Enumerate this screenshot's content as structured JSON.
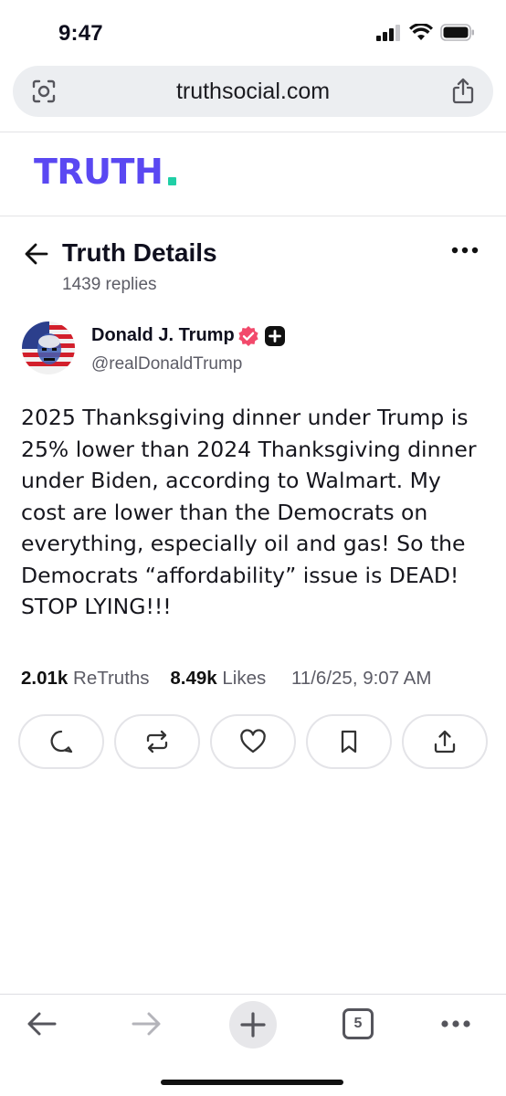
{
  "status_bar": {
    "time": "9:47"
  },
  "browser": {
    "url": "truthsocial.com",
    "tab_count": "5"
  },
  "brand": {
    "logo_text": "TRUTH",
    "color": "#5a48f2",
    "accent": "#20cfa6"
  },
  "header": {
    "title": "Truth Details",
    "replies": "1439 replies"
  },
  "author": {
    "name": "Donald J. Trump",
    "handle": "@realDonaldTrump"
  },
  "post": {
    "text": "2025 Thanksgiving dinner under Trump is 25% lower than 2024 Thanksgiving dinner under Biden, according to Walmart. My cost are lower than the Democrats on everything, especially oil and gas! So the Democrats “affordability” issue is DEAD! STOP LYING!!!",
    "retruths_count": "2.01k",
    "retruths_label": "ReTruths",
    "likes_count": "8.49k",
    "likes_label": "Likes",
    "timestamp": "11/6/25, 9:07 AM"
  },
  "actions": [
    "comment-icon",
    "retruth-icon",
    "like-icon",
    "bookmark-icon",
    "share-icon"
  ],
  "toolbar": [
    "back-icon",
    "forward-icon",
    "new-tab-icon",
    "tabs-icon",
    "more-icon"
  ]
}
